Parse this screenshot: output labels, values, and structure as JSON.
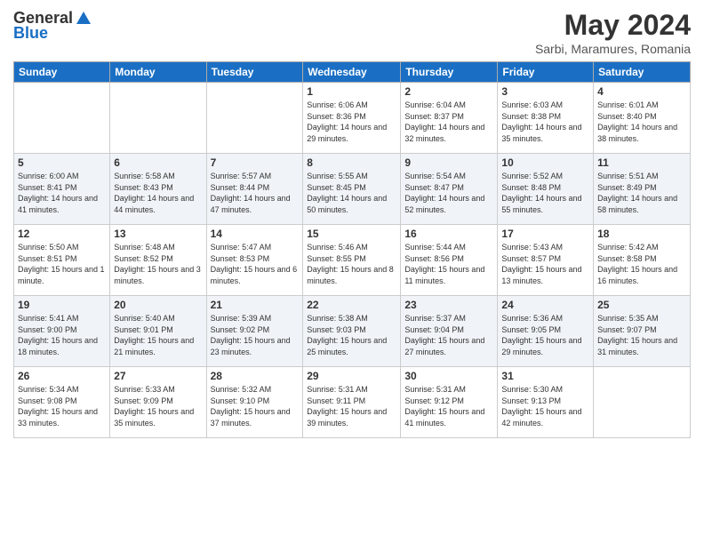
{
  "logo": {
    "general": "General",
    "blue": "Blue"
  },
  "title": "May 2024",
  "location": "Sarbi, Maramures, Romania",
  "days_of_week": [
    "Sunday",
    "Monday",
    "Tuesday",
    "Wednesday",
    "Thursday",
    "Friday",
    "Saturday"
  ],
  "weeks": [
    [
      {
        "num": "",
        "info": ""
      },
      {
        "num": "",
        "info": ""
      },
      {
        "num": "",
        "info": ""
      },
      {
        "num": "1",
        "info": "Sunrise: 6:06 AM\nSunset: 8:36 PM\nDaylight: 14 hours\nand 29 minutes."
      },
      {
        "num": "2",
        "info": "Sunrise: 6:04 AM\nSunset: 8:37 PM\nDaylight: 14 hours\nand 32 minutes."
      },
      {
        "num": "3",
        "info": "Sunrise: 6:03 AM\nSunset: 8:38 PM\nDaylight: 14 hours\nand 35 minutes."
      },
      {
        "num": "4",
        "info": "Sunrise: 6:01 AM\nSunset: 8:40 PM\nDaylight: 14 hours\nand 38 minutes."
      }
    ],
    [
      {
        "num": "5",
        "info": "Sunrise: 6:00 AM\nSunset: 8:41 PM\nDaylight: 14 hours\nand 41 minutes."
      },
      {
        "num": "6",
        "info": "Sunrise: 5:58 AM\nSunset: 8:43 PM\nDaylight: 14 hours\nand 44 minutes."
      },
      {
        "num": "7",
        "info": "Sunrise: 5:57 AM\nSunset: 8:44 PM\nDaylight: 14 hours\nand 47 minutes."
      },
      {
        "num": "8",
        "info": "Sunrise: 5:55 AM\nSunset: 8:45 PM\nDaylight: 14 hours\nand 50 minutes."
      },
      {
        "num": "9",
        "info": "Sunrise: 5:54 AM\nSunset: 8:47 PM\nDaylight: 14 hours\nand 52 minutes."
      },
      {
        "num": "10",
        "info": "Sunrise: 5:52 AM\nSunset: 8:48 PM\nDaylight: 14 hours\nand 55 minutes."
      },
      {
        "num": "11",
        "info": "Sunrise: 5:51 AM\nSunset: 8:49 PM\nDaylight: 14 hours\nand 58 minutes."
      }
    ],
    [
      {
        "num": "12",
        "info": "Sunrise: 5:50 AM\nSunset: 8:51 PM\nDaylight: 15 hours\nand 1 minute."
      },
      {
        "num": "13",
        "info": "Sunrise: 5:48 AM\nSunset: 8:52 PM\nDaylight: 15 hours\nand 3 minutes."
      },
      {
        "num": "14",
        "info": "Sunrise: 5:47 AM\nSunset: 8:53 PM\nDaylight: 15 hours\nand 6 minutes."
      },
      {
        "num": "15",
        "info": "Sunrise: 5:46 AM\nSunset: 8:55 PM\nDaylight: 15 hours\nand 8 minutes."
      },
      {
        "num": "16",
        "info": "Sunrise: 5:44 AM\nSunset: 8:56 PM\nDaylight: 15 hours\nand 11 minutes."
      },
      {
        "num": "17",
        "info": "Sunrise: 5:43 AM\nSunset: 8:57 PM\nDaylight: 15 hours\nand 13 minutes."
      },
      {
        "num": "18",
        "info": "Sunrise: 5:42 AM\nSunset: 8:58 PM\nDaylight: 15 hours\nand 16 minutes."
      }
    ],
    [
      {
        "num": "19",
        "info": "Sunrise: 5:41 AM\nSunset: 9:00 PM\nDaylight: 15 hours\nand 18 minutes."
      },
      {
        "num": "20",
        "info": "Sunrise: 5:40 AM\nSunset: 9:01 PM\nDaylight: 15 hours\nand 21 minutes."
      },
      {
        "num": "21",
        "info": "Sunrise: 5:39 AM\nSunset: 9:02 PM\nDaylight: 15 hours\nand 23 minutes."
      },
      {
        "num": "22",
        "info": "Sunrise: 5:38 AM\nSunset: 9:03 PM\nDaylight: 15 hours\nand 25 minutes."
      },
      {
        "num": "23",
        "info": "Sunrise: 5:37 AM\nSunset: 9:04 PM\nDaylight: 15 hours\nand 27 minutes."
      },
      {
        "num": "24",
        "info": "Sunrise: 5:36 AM\nSunset: 9:05 PM\nDaylight: 15 hours\nand 29 minutes."
      },
      {
        "num": "25",
        "info": "Sunrise: 5:35 AM\nSunset: 9:07 PM\nDaylight: 15 hours\nand 31 minutes."
      }
    ],
    [
      {
        "num": "26",
        "info": "Sunrise: 5:34 AM\nSunset: 9:08 PM\nDaylight: 15 hours\nand 33 minutes."
      },
      {
        "num": "27",
        "info": "Sunrise: 5:33 AM\nSunset: 9:09 PM\nDaylight: 15 hours\nand 35 minutes."
      },
      {
        "num": "28",
        "info": "Sunrise: 5:32 AM\nSunset: 9:10 PM\nDaylight: 15 hours\nand 37 minutes."
      },
      {
        "num": "29",
        "info": "Sunrise: 5:31 AM\nSunset: 9:11 PM\nDaylight: 15 hours\nand 39 minutes."
      },
      {
        "num": "30",
        "info": "Sunrise: 5:31 AM\nSunset: 9:12 PM\nDaylight: 15 hours\nand 41 minutes."
      },
      {
        "num": "31",
        "info": "Sunrise: 5:30 AM\nSunset: 9:13 PM\nDaylight: 15 hours\nand 42 minutes."
      },
      {
        "num": "",
        "info": ""
      }
    ]
  ]
}
